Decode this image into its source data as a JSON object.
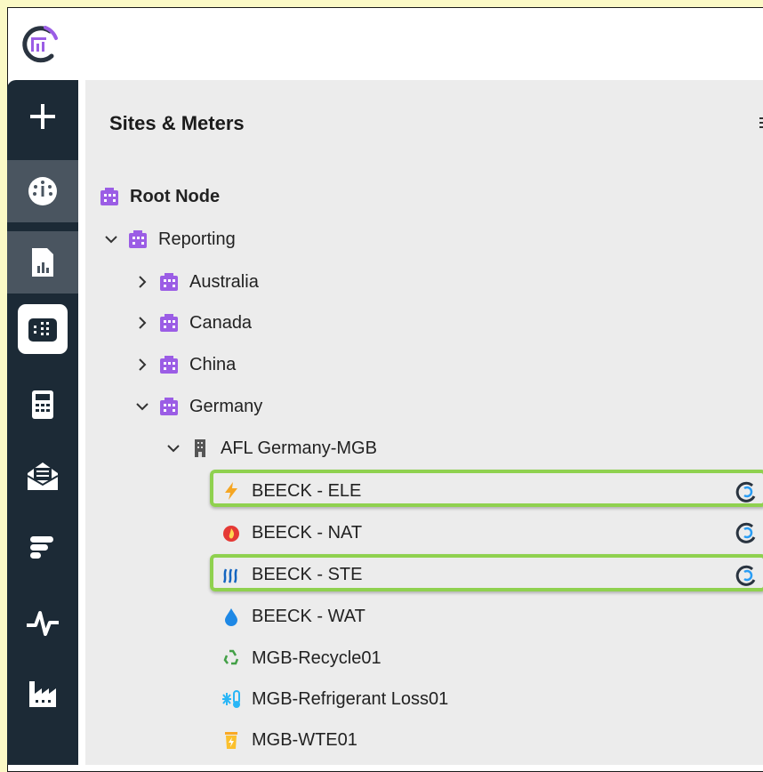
{
  "panel": {
    "title": "Sites & Meters"
  },
  "tree": {
    "root": "Root Node",
    "reporting": "Reporting",
    "countries": [
      "Australia",
      "Canada",
      "China",
      "Germany"
    ],
    "site": "AFL Germany-MGB",
    "meters": [
      {
        "label": "BEECK - ELE",
        "icon": "lightning-icon",
        "highlighted": true,
        "status_icon": "refresh-status-icon"
      },
      {
        "label": "BEECK - NAT",
        "icon": "flame-icon",
        "highlighted": false,
        "status_icon": "refresh-status-icon"
      },
      {
        "label": "BEECK - STE",
        "icon": "steam-icon",
        "highlighted": true,
        "status_icon": "refresh-status-icon"
      },
      {
        "label": "BEECK - WAT",
        "icon": "water-drop-icon",
        "highlighted": false
      },
      {
        "label": "MGB-Recycle01",
        "icon": "recycle-icon",
        "highlighted": false
      },
      {
        "label": "MGB-Refrigerant Loss01",
        "icon": "refrigerant-icon",
        "highlighted": false
      },
      {
        "label": "MGB-WTE01",
        "icon": "waste-to-energy-icon",
        "highlighted": false
      }
    ]
  },
  "sidebar": {
    "items": [
      "add-icon",
      "dashboard-gauge-icon",
      "report-icon",
      "sites-meters-icon",
      "calculator-icon",
      "mail-icon",
      "bars-icon",
      "pulse-icon",
      "factory-icon"
    ]
  },
  "colors": {
    "sidebar_bg": "#1c2a36",
    "building_purple": "#9b5de5",
    "highlight_green": "#8fd14f",
    "page_bg": "#fbf9c6"
  }
}
